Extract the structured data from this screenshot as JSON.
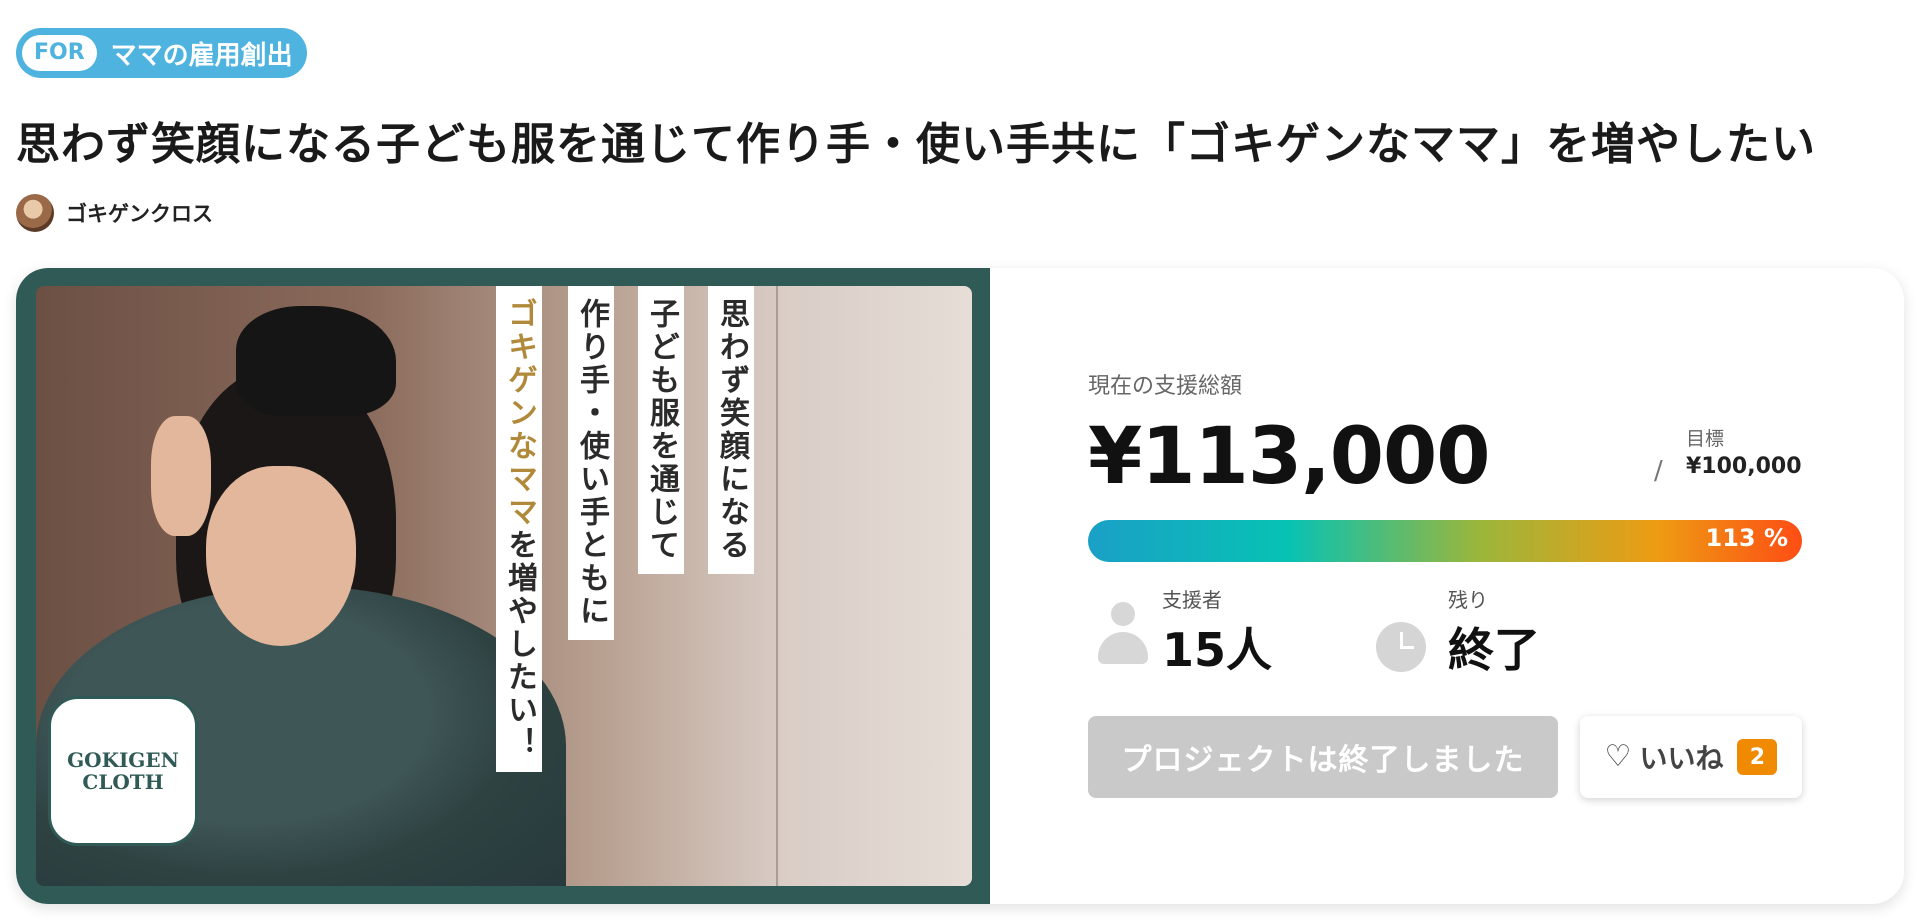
{
  "tag": {
    "for_label": "FOR",
    "label": "ママの雇用創出"
  },
  "title": "思わず笑顔になる子ども服を通じて作り手・使い手共に「ゴキゲンなママ」を増やしたい",
  "author": {
    "name": "ゴキゲンクロス"
  },
  "hero": {
    "banners": [
      "思わず笑顔になる",
      "子ども服を通じて",
      "作り手・使い手ともに",
      "ゴキゲンなママ",
      "を増やしたい！"
    ],
    "logo_text": [
      "GOKIGEN",
      "CLOTH"
    ]
  },
  "funding": {
    "current_label": "現在の支援総額",
    "amount": "¥113,000",
    "slash": "/",
    "goal_label": "目標",
    "goal_value": "¥100,000",
    "progress_percent": 113,
    "progress_text": "113 %"
  },
  "stats": {
    "supporters_label": "支援者",
    "supporters_value": "15人",
    "remaining_label": "残り",
    "remaining_value": "終了"
  },
  "actions": {
    "ended_label": "プロジェクトは終了しました",
    "like_label": "いいね",
    "like_count": "2"
  },
  "colors": {
    "tag": "#4fb3df",
    "panel": "#2f5a55",
    "badge": "#f08a00",
    "ended_button": "#c9c9c9"
  }
}
